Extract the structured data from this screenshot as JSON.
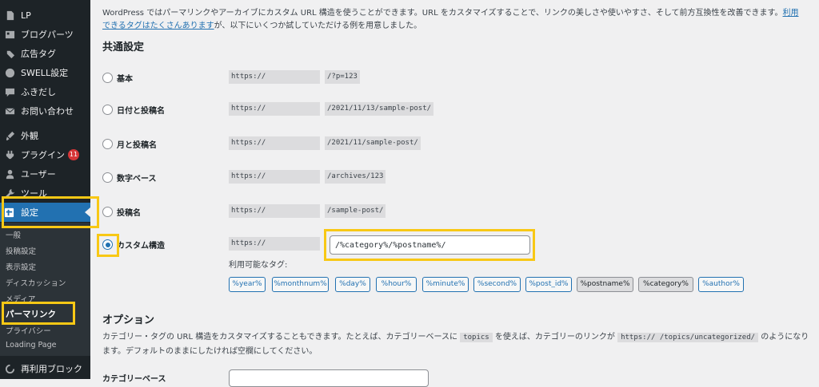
{
  "sidebar": {
    "items": [
      {
        "label": "LP",
        "icon": "page-icon"
      },
      {
        "label": "ブログパーツ",
        "icon": "blocks-icon"
      },
      {
        "label": "広告タグ",
        "icon": "tag-icon"
      },
      {
        "label": "SWELL設定",
        "icon": "swell-icon"
      },
      {
        "label": "ふきだし",
        "icon": "speech-bubble-icon"
      },
      {
        "label": "お問い合わせ",
        "icon": "mail-icon"
      },
      {
        "label": "外観",
        "icon": "paint-brush-icon"
      },
      {
        "label": "プラグイン",
        "icon": "plugin-icon",
        "badge": "11"
      },
      {
        "label": "ユーザー",
        "icon": "user-icon"
      },
      {
        "label": "ツール",
        "icon": "wrench-icon"
      },
      {
        "label": "設定",
        "icon": "settings-icon",
        "current": true
      }
    ],
    "submenu": [
      {
        "label": "一般"
      },
      {
        "label": "投稿設定"
      },
      {
        "label": "表示設定"
      },
      {
        "label": "ディスカッション"
      },
      {
        "label": "メディア"
      },
      {
        "label": "パーマリンク",
        "current": true
      },
      {
        "label": "プライバシー"
      },
      {
        "label": "Loading Page"
      }
    ],
    "bottom_item": {
      "label": "再利用ブロック",
      "icon": "reusable-block-icon"
    }
  },
  "intro": {
    "text": "WordPress ではパーマリンクやアーカイブにカスタム URL 構造を使うことができます。URL をカスタマイズすることで、リンクの美しさや使いやすさ、そして前方互換性を改善できます。",
    "link": "利用できるタグはたくさんあります",
    "text_after": "が、以下にいくつか試していただける例を用意しました。"
  },
  "common": {
    "title": "共通設定",
    "host": "https://",
    "options": [
      {
        "label": "基本",
        "path": "/?p=123",
        "checked": false
      },
      {
        "label": "日付と投稿名",
        "path": "/2021/11/13/sample-post/",
        "checked": false
      },
      {
        "label": "月と投稿名",
        "path": "/2021/11/sample-post/",
        "checked": false
      },
      {
        "label": "数字ベース",
        "path": "/archives/123",
        "checked": false
      },
      {
        "label": "投稿名",
        "path": "/sample-post/",
        "checked": false
      },
      {
        "label": "カスタム構造",
        "checked": true
      }
    ],
    "custom_value": "/%category%/%postname%/",
    "available_tags_label": "利用可能なタグ:",
    "tags": [
      {
        "label": "%year%",
        "active": false
      },
      {
        "label": "%monthnum%",
        "active": false
      },
      {
        "label": "%day%",
        "active": false
      },
      {
        "label": "%hour%",
        "active": false
      },
      {
        "label": "%minute%",
        "active": false
      },
      {
        "label": "%second%",
        "active": false
      },
      {
        "label": "%post_id%",
        "active": false
      },
      {
        "label": "%postname%",
        "active": true
      },
      {
        "label": "%category%",
        "active": true
      },
      {
        "label": "%author%",
        "active": false
      }
    ]
  },
  "options": {
    "title": "オプション",
    "text1": "カテゴリー・タグの URL 構造をカスタマイズすることもできます。たとえば、カテゴリーベースに",
    "code1": "topics",
    "text2": "を使えば、カテゴリーのリンクが",
    "code2": "https://              /topics/uncategorized/",
    "text3": "のようになります。デフォルトのままにしたければ空欄にしてください。",
    "category_base_label": "カテゴリーベース"
  },
  "colors": {
    "accent": "#2271b1",
    "highlight": "#f8c815",
    "sidebar": "#1d2327"
  }
}
